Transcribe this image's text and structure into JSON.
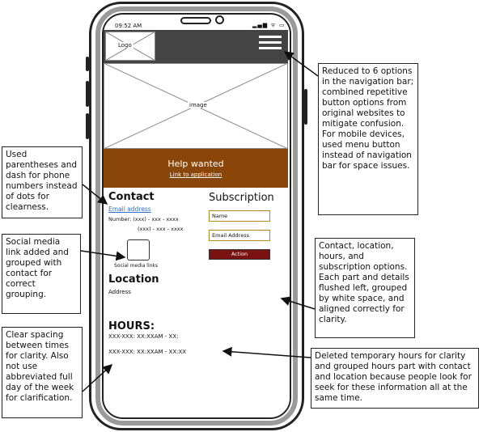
{
  "phone": {
    "status_time": "09:52 AM",
    "status_icons": "▂▄▆ ᯤ ▭",
    "logo_label": "Logo",
    "image_label": "image",
    "help_title": "Help wanted",
    "help_link": "Link to application",
    "contact_title": "Contact",
    "email_link": "Email address",
    "phone_line1": "Number: (xxx) - xxx - xxxx",
    "phone_line2": "(xxx) - xxx - xxxx",
    "social_label": "Social media links",
    "location_title": "Location",
    "address": "Address",
    "hours_title": "HOURS:",
    "hours_line1": "XXX-XXX: XX:XXAM - XX:",
    "hours_line2": "XXX-XXX: XX:XXAM - XX:XX",
    "subscription_title": "Subscription",
    "name_field": "Name",
    "email_field": "Email Address",
    "action_label": "Action"
  },
  "annotations": {
    "nav": "Reduced to 6 options in the navigation bar; combined repetitive button options from original websites to mitigate confusion. For mobile devices, used menu button instead of navigation bar for space issues.",
    "phone_format": "Used parentheses and dash for phone numbers instead of dots for clearness.",
    "social": "Social media link added and grouped with contact for correct grouping.",
    "layout": "Contact, location, hours, and subscription options. Each part and details flushed left, grouped by white space, and aligned correctly for clarity.",
    "hours_spacing": "Clear spacing between times for clarity. Also not use abbreviated full day of the week for clarification.",
    "hours_grouping": "Deleted temporary hours for clarity and grouped hours part with contact and location because people look for seek for these information all at the same time."
  },
  "colors": {
    "navbar": "#444444",
    "banner": "#8a4608",
    "action_button": "#7a1212",
    "link": "#2a6fd0",
    "field_border": "#b08a1a"
  }
}
